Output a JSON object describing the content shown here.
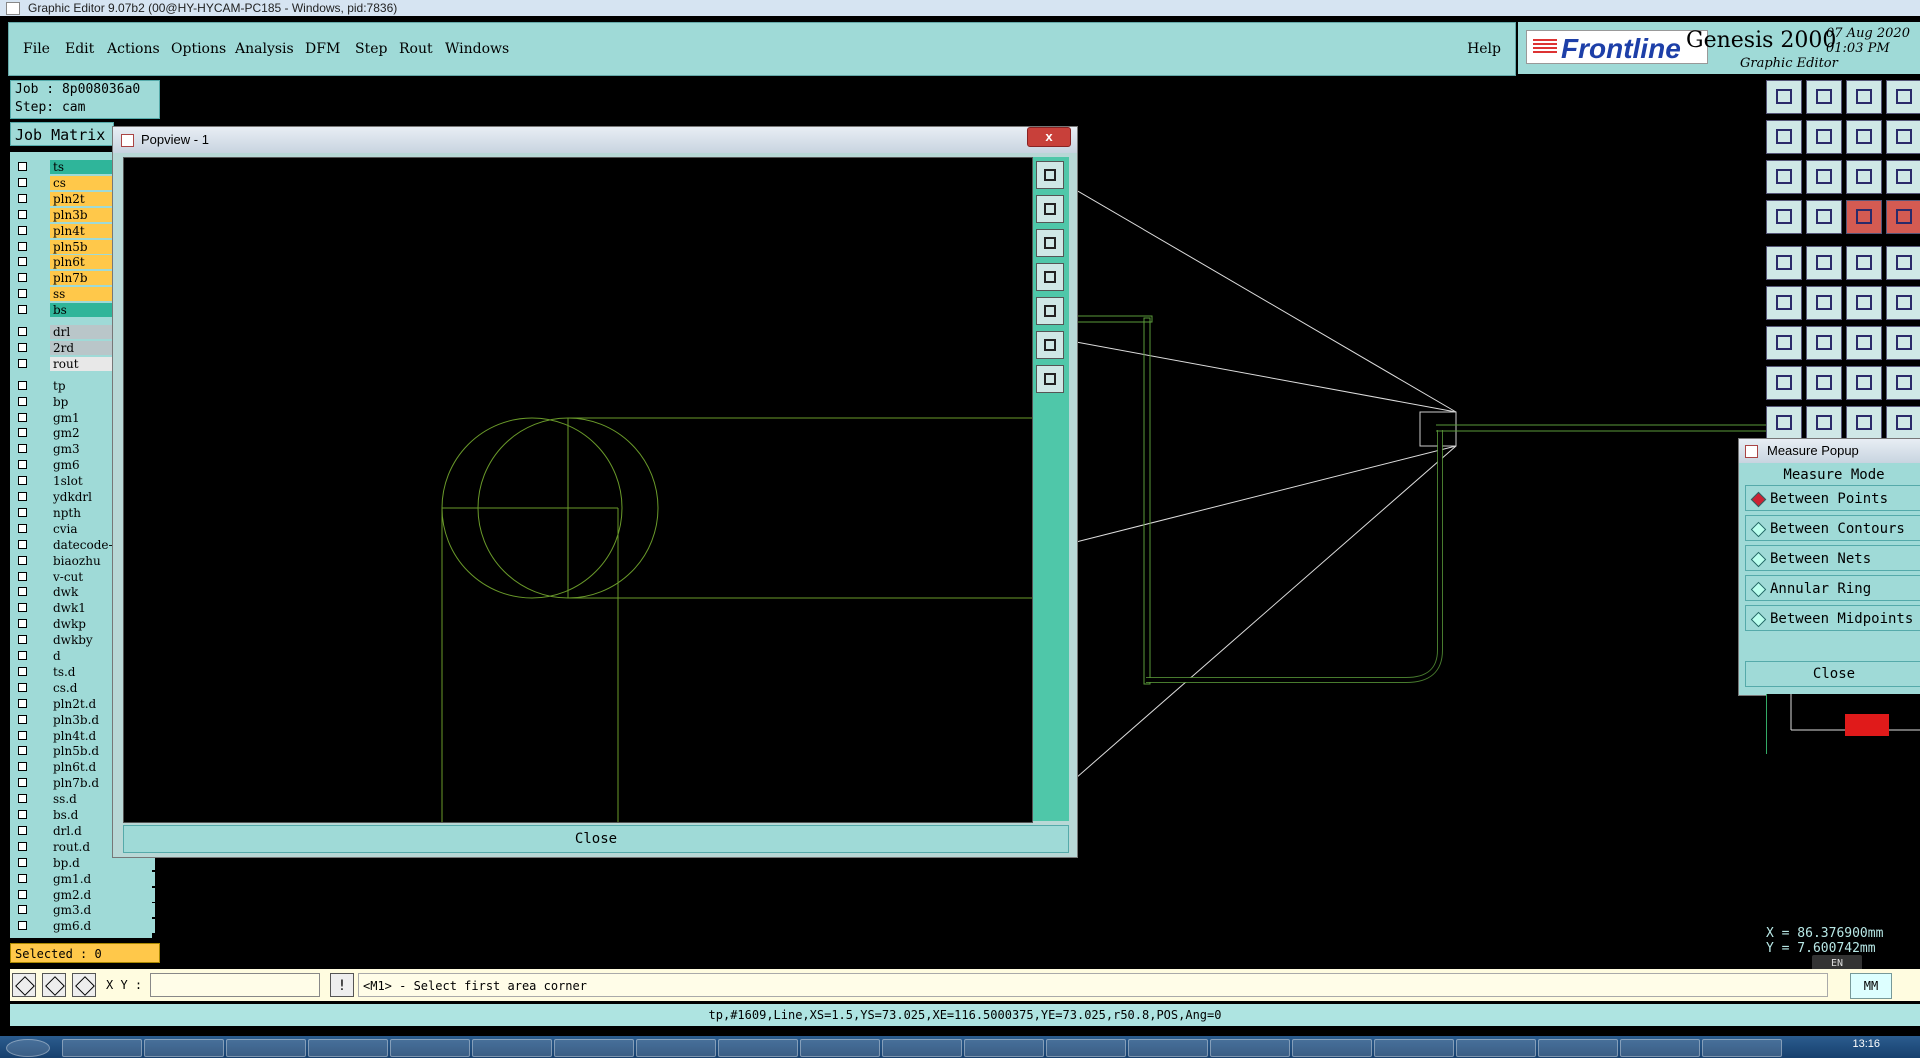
{
  "window": {
    "title": "Graphic Editor 9.07b2 (00@HY-HYCAM-PC185 - Windows, pid:7836)"
  },
  "menu": {
    "items": [
      "File",
      "Edit",
      "Actions",
      "Options",
      "Analysis",
      "DFM",
      "Step",
      "Rout",
      "Windows"
    ],
    "help": "Help"
  },
  "brand": {
    "logo": "Frontline",
    "product": "Genesis 2000",
    "subtitle": "Graphic Editor",
    "date": "07 Aug 2020",
    "time": "01:03 PM"
  },
  "job": {
    "job_line": "Job : 8p008036a0",
    "step_line": "Step: cam",
    "matrix_button": "Job Matrix"
  },
  "layers": [
    {
      "name": "ts",
      "color": "#2fb59a"
    },
    {
      "name": "cs",
      "color": "#ffc84a"
    },
    {
      "name": "pln2t",
      "color": "#ffc84a"
    },
    {
      "name": "pln3b",
      "color": "#ffc84a"
    },
    {
      "name": "pln4t",
      "color": "#ffc84a"
    },
    {
      "name": "pln5b",
      "color": "#ffc84a"
    },
    {
      "name": "pln6t",
      "color": "#ffc84a"
    },
    {
      "name": "pln7b",
      "color": "#ffc84a"
    },
    {
      "name": "ss",
      "color": "#ffc84a"
    },
    {
      "name": "bs",
      "color": "#2fb59a"
    },
    {
      "name": "drl",
      "color": "#b9c6c9"
    },
    {
      "name": "2rd",
      "color": "#b9c6c9"
    },
    {
      "name": "rout",
      "color": "#e8e8e8"
    },
    {
      "name": "tp",
      "color": "#9fdad7"
    },
    {
      "name": "bp",
      "color": "#9fdad7"
    },
    {
      "name": "gm1",
      "color": "#9fdad7"
    },
    {
      "name": "gm2",
      "color": "#9fdad7"
    },
    {
      "name": "gm3",
      "color": "#9fdad7"
    },
    {
      "name": "gm6",
      "color": "#9fdad7"
    },
    {
      "name": "1slot",
      "color": "#9fdad7"
    },
    {
      "name": "ydkdrl",
      "color": "#9fdad7"
    },
    {
      "name": "npth",
      "color": "#9fdad7"
    },
    {
      "name": "cvia",
      "color": "#9fdad7"
    },
    {
      "name": "datecode-",
      "color": "#9fdad7"
    },
    {
      "name": "biaozhu",
      "color": "#9fdad7"
    },
    {
      "name": "v-cut",
      "color": "#9fdad7"
    },
    {
      "name": "dwk",
      "color": "#9fdad7"
    },
    {
      "name": "dwk1",
      "color": "#9fdad7"
    },
    {
      "name": "dwkp",
      "color": "#9fdad7"
    },
    {
      "name": "dwkby",
      "color": "#9fdad7"
    },
    {
      "name": "d",
      "color": "#9fdad7"
    },
    {
      "name": "ts.d",
      "color": "#9fdad7"
    },
    {
      "name": "cs.d",
      "color": "#9fdad7"
    },
    {
      "name": "pln2t.d",
      "color": "#9fdad7"
    },
    {
      "name": "pln3b.d",
      "color": "#9fdad7"
    },
    {
      "name": "pln4t.d",
      "color": "#9fdad7"
    },
    {
      "name": "pln5b.d",
      "color": "#9fdad7"
    },
    {
      "name": "pln6t.d",
      "color": "#9fdad7"
    },
    {
      "name": "pln7b.d",
      "color": "#9fdad7"
    },
    {
      "name": "ss.d",
      "color": "#9fdad7"
    },
    {
      "name": "bs.d",
      "color": "#9fdad7"
    },
    {
      "name": "drl.d",
      "color": "#9fdad7"
    },
    {
      "name": "rout.d",
      "color": "#9fdad7"
    },
    {
      "name": "bp.d",
      "color": "#9fdad7"
    },
    {
      "name": "gm1.d",
      "color": "#9fdad7"
    },
    {
      "name": "gm2.d",
      "color": "#9fdad7"
    },
    {
      "name": "gm3.d",
      "color": "#9fdad7"
    },
    {
      "name": "gm6.d",
      "color": "#9fdad7"
    }
  ],
  "selected": "Selected : 0",
  "popview": {
    "title": "Popview - 1",
    "close": "Close",
    "close_x": "x"
  },
  "measure": {
    "title": "Measure Popup",
    "mode_label": "Measure Mode",
    "options": [
      "Between Points",
      "Between Contours",
      "Between Nets",
      "Annular Ring",
      "Between Midpoints"
    ],
    "selected_index": 0,
    "close": "Close"
  },
  "coords": {
    "x": "X = 86.376900mm",
    "y": "Y = 7.600742mm"
  },
  "command": {
    "xy_label": "X Y :",
    "xy_value": "",
    "bang": "!",
    "prompt": "<M1> - Select first area corner",
    "unit": "MM"
  },
  "info": "tp,#1609,Line,XS=1.5,YS=73.025,XE=116.5000375,YE=73.025,r50.8,POS,Ang=0",
  "ime": "EN",
  "taskbar": {
    "clock": "13:16"
  }
}
